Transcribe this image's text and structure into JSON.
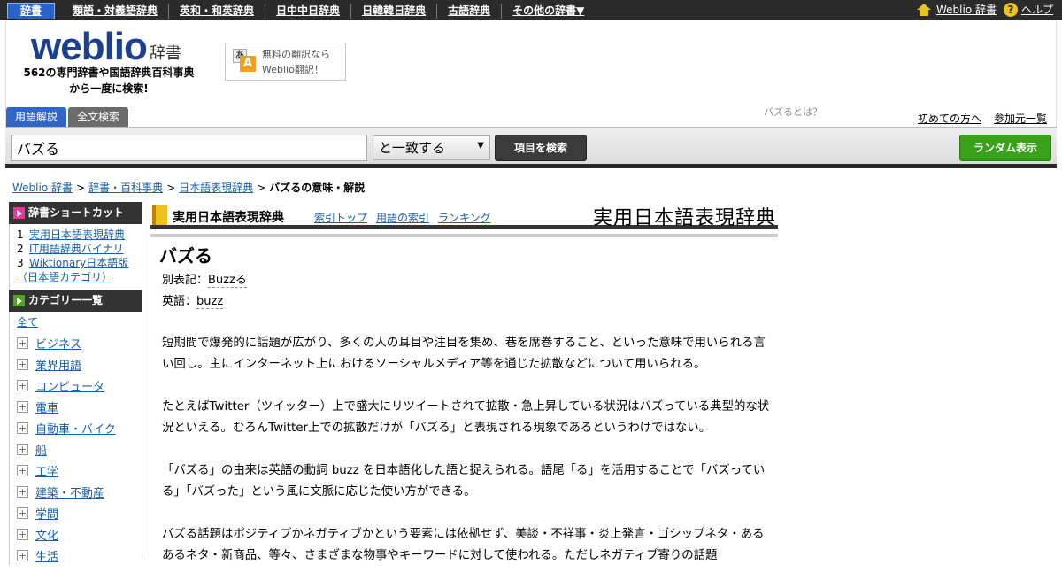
{
  "topnav": {
    "items": [
      "辞書",
      "類語・対義語辞典",
      "英和・和英辞典",
      "日中中日辞典",
      "日韓韓日辞典",
      "古語辞典",
      "その他の辞書▼"
    ],
    "home_link": "Weblio 辞書",
    "help_link": "ヘルプ",
    "help_glyph": "?"
  },
  "header": {
    "logo_word": "weblio",
    "logo_suffix": "辞書",
    "tagline_1": "562の専門辞書や国語辞典百科事典",
    "tagline_2": "から一度に検索!",
    "translate_line1": "無料の翻訳なら",
    "translate_line2": "Weblio翻訳！",
    "translate_icon_a": "あ",
    "translate_icon_b": "A",
    "tabs": [
      "用語解説",
      "全文検索"
    ],
    "whatis": "バズるとは？",
    "links": [
      "初めての方へ",
      "参加元一覧"
    ]
  },
  "search": {
    "query": "バズる",
    "match_mode": "と一致する",
    "search_label": "項目を検索",
    "random_label": "ランダム表示"
  },
  "breadcrumb": [
    "Weblio 辞書",
    "辞書・百科事典",
    "日本語表現辞典",
    "バズるの意味・解説"
  ],
  "sidebar": {
    "shortcut_title": "辞書ショートカット",
    "shortcuts": [
      {
        "idx": "1",
        "label": "実用日本語表現辞典"
      },
      {
        "idx": "2",
        "label": "IT用語辞典バイナリ"
      },
      {
        "idx": "3",
        "label": "Wiktionary日本語版（日本語カテゴリ）"
      }
    ],
    "category_title": "カテゴリー一覧",
    "category_all": "全て",
    "categories": [
      "ビジネス",
      "業界用語",
      "コンピュータ",
      "電車",
      "自動車・バイク",
      "船",
      "工学",
      "建築・不動産",
      "学問",
      "文化",
      "生活"
    ]
  },
  "dictionary": {
    "name": "実用日本語表現辞典",
    "links": [
      "索引トップ",
      "用語の索引",
      "ランキング"
    ],
    "logo_text": "実用日本語表現辞典"
  },
  "entry": {
    "title": "バズる",
    "alt_label": "別表記：",
    "alt_value": "Buzzる",
    "en_label": "英語：",
    "en_value": "buzz",
    "paragraphs": [
      "短期間で爆発的に話題が広がり、多くの人の耳目や注目を集め、巷を席巻すること、といった意味で用いられる言い回し。主にインターネット上におけるソーシャルメディア等を通じた拡散などについて用いられる。",
      "たとえばTwitter（ツイッター）上で盛大にリツイートされて拡散・急上昇している状況はバズっている典型的な状況といえる。むろんTwitter上での拡散だけが「バズる」と表現される現象であるというわけではない。",
      "「バズる」の由来は英語の動詞 buzz を日本語化した語と捉えられる。語尾「る」を活用することで「バズっている」「バズった」という風に文脈に応じた使い方ができる。",
      "バズる話題はポジティブかネガティブかという要素には依拠せず、美談・不祥事・炎上発言・ゴシップネタ・あるあるネタ・新商品、等々、さまざまな物事やキーワードに対して使われる。ただしネガティブ寄りの話題"
    ]
  },
  "colors": {
    "topbar": "#2b2b2b",
    "accent_blue": "#3165c6",
    "link": "#1a5fa8",
    "random_green": "#3aa11a"
  }
}
